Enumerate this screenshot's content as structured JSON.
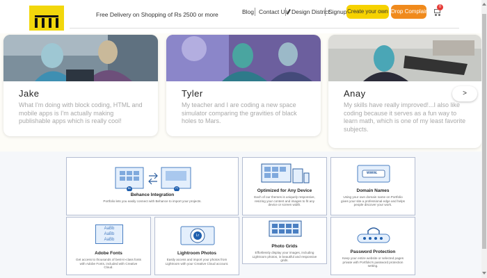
{
  "header": {
    "free_delivery": "Free Delivery on Shopping of Rs 2500 or more",
    "nav": {
      "blog": "Blog",
      "contact": "Contact Us",
      "design": "Design District",
      "signup": "Signup"
    },
    "create_button": "Create your own",
    "drop_button": "Drop Complaint",
    "cart_count": "0"
  },
  "testimonials": [
    {
      "name": "Jake",
      "text": "What I'm doing with block coding, HTML and mobile apps is I'm actually making publishable apps which is really cool!"
    },
    {
      "name": "Tyler",
      "text": "My teacher and I are coding a new space simulator comparing the gravities of black holes to Mars."
    },
    {
      "name": "Anay",
      "text": "My skills have really improved!...I also like coding because it serves as a fun way to learn math, which is one of my least favorite subjects."
    }
  ],
  "next_arrow": ">",
  "features": [
    {
      "title": "Behance Integration",
      "desc": "Portfolio lets you easily connect with Behance to import your projects.",
      "badges": [
        "Be",
        "Pf"
      ]
    },
    {
      "title": "Optimized for Any Device",
      "desc": "Each of our themes is uniquely responsive, resizing your content and images to fit any device or screen width."
    },
    {
      "title": "Domain Names",
      "desc": "Using your own domain name on Portfolio gives your site a professional edge and helps people discover your work.",
      "url_label": "www."
    },
    {
      "title": "Adobe Fonts",
      "desc": "Get access to thousands of best-in-class fonts with Adobe Fonts, included with Creative Cloud.",
      "font_samples": [
        "AaBb",
        "AaBb",
        "AaBb"
      ]
    },
    {
      "title": "Lightroom Photos",
      "desc": "Easily access and import your photos from Lightroom with your Creative Cloud account.",
      "badge": "Lr"
    },
    {
      "title": "Photo Grids",
      "desc": "Effortlessly display your images, including Lightroom photos, in beautiful and responsive grids."
    },
    {
      "title": "Password Protection",
      "desc": "Keep your entire website or selected pages private with Portfolio's password protection setting."
    }
  ]
}
